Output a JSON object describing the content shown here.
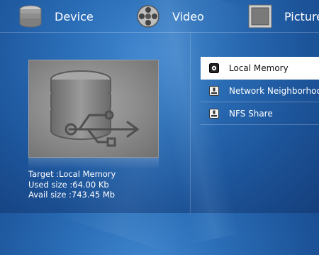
{
  "tabs": {
    "device": {
      "label": "Device",
      "icon": "database-icon"
    },
    "video": {
      "label": "Video",
      "icon": "film-reel-icon"
    },
    "picture": {
      "label": "Picture",
      "icon": "picture-frame-icon"
    }
  },
  "preview": {
    "icon": "usb-database-icon"
  },
  "info": {
    "target": "Target :Local Memory",
    "used": "Used size :64.00 Kb",
    "avail": "Avail size :743.45 Mb"
  },
  "sources": [
    {
      "label": "Local Memory",
      "icon": "drive-icon",
      "selected": true
    },
    {
      "label": "Network Neighborhood",
      "icon": "network-drive-icon",
      "selected": false
    },
    {
      "label": "NFS Share",
      "icon": "network-drive-icon",
      "selected": false
    }
  ],
  "colors": {
    "selected_bg": "#ffffff",
    "accent_blue": "#2b6fb8"
  }
}
